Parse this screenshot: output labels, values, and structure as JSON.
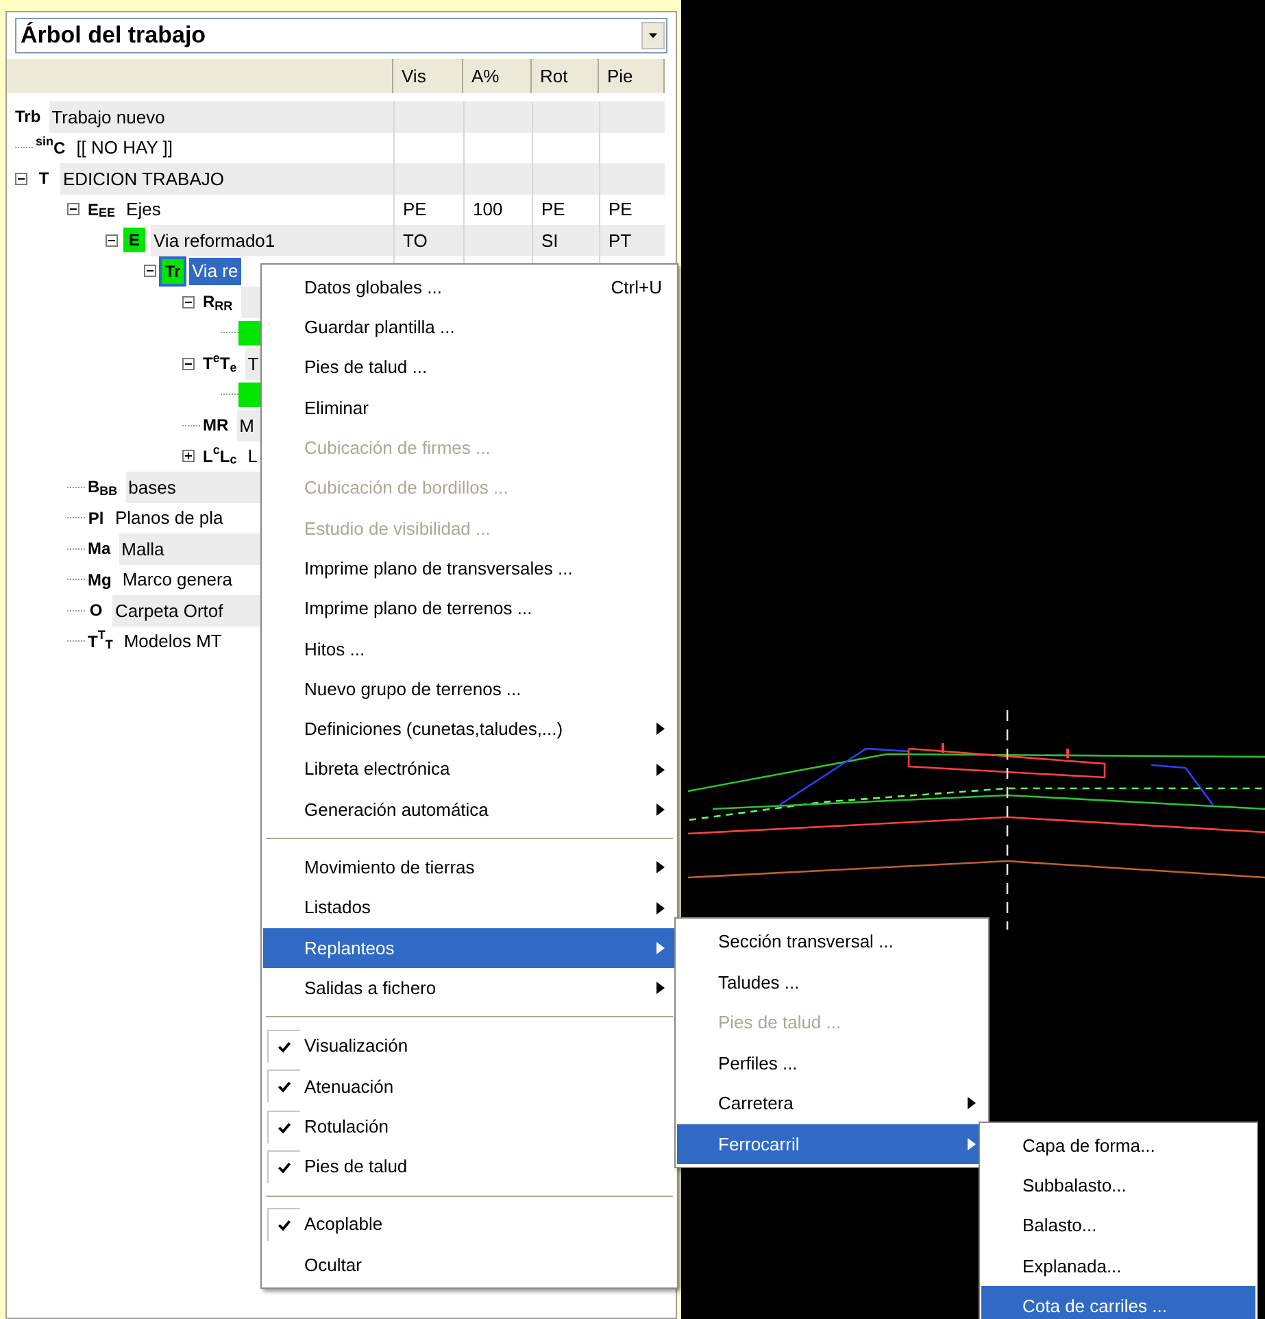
{
  "tree_panel": {
    "title": "Árbol del trabajo",
    "columns": [
      "Vis",
      "A%",
      "Rot",
      "Pie"
    ],
    "rows": [
      {
        "badge": "Trb",
        "label": "Trabajo nuevo",
        "selected": false,
        "children": [
          {
            "badge": "$^{sin}$C",
            "label": "[[ NO HAY ]]",
            "selected": false
          },
          {
            "badge": "T",
            "label": "EDICION TRABAJO",
            "selected": false,
            "expanded": true,
            "children": [
              {
                "badge": "E$_{E}$$_{E}$",
                "label": "Ejes",
                "selected": false,
                "expanded": true,
                "cells": [
                  "PE",
                  "100",
                  "PE",
                  "PE"
                ],
                "children": [
                  {
                    "badge": "E",
                    "color": "#00e600",
                    "label": "Via reformado1",
                    "selected": false,
                    "expanded": true,
                    "cells": [
                      "TO",
                      null,
                      "SI",
                      "PT"
                    ],
                    "children": [
                      {
                        "badge": "Tr",
                        "color": "#00e600",
                        "label": "Via re",
                        "selected": true,
                        "expanded": true,
                        "children": [
                          {
                            "badge": "R$_{R}$$_{R}$",
                            "selected": false,
                            "expanded": true,
                            "children": [
                              {
                                "color": "#00e600",
                                "selected": false
                              }
                            ]
                          },
                          {
                            "badge": "T$^{e}$T$_{e}$",
                            "label": "T",
                            "selected": false,
                            "expanded": true,
                            "children": [
                              {
                                "color": "#00e600",
                                "selected": false
                              }
                            ]
                          },
                          {
                            "badge": "MR",
                            "label": "M",
                            "selected": false
                          },
                          {
                            "badge": "L$^{c}$L$_{c}$",
                            "label": "L",
                            "selected": false,
                            "expanded": false
                          }
                        ]
                      }
                    ]
                  }
                ]
              },
              {
                "badge": "B$_{B}$$_{B}$",
                "label": "bases",
                "selected": false
              },
              {
                "badge": "Pl",
                "label": "Planos de pla",
                "selected": false
              },
              {
                "badge": "Ma",
                "label": "Malla",
                "selected": false
              },
              {
                "badge": "Mg",
                "label": "Marco genera",
                "selected": false
              },
              {
                "badge": "O",
                "label": "Carpeta Ortof",
                "selected": false
              },
              {
                "badge": "T$^{T}$$_{T}$",
                "label": "Modelos MT",
                "selected": false
              }
            ]
          }
        ]
      }
    ]
  },
  "context_menu": {
    "items": [
      {
        "label": "Datos globales ...",
        "shortcut": "Ctrl+U",
        "disabled": false,
        "selected": false
      },
      {
        "label": "Guardar plantilla ...",
        "disabled": false,
        "selected": false
      },
      {
        "label": "Pies de talud ...",
        "disabled": false,
        "selected": false
      },
      {
        "label": "Eliminar",
        "disabled": false,
        "selected": false
      },
      {
        "label": "Cubicación de firmes ...",
        "disabled": true,
        "selected": false
      },
      {
        "label": "Cubicación de bordillos ...",
        "disabled": true,
        "selected": false
      },
      {
        "label": "Estudio de visibilidad ...",
        "disabled": true,
        "selected": false
      },
      {
        "label": "Imprime plano de transversales ...",
        "disabled": false,
        "selected": false
      },
      {
        "label": "Imprime plano de terrenos ...",
        "disabled": false,
        "selected": false
      },
      {
        "label": "Hitos ...",
        "disabled": false,
        "selected": false
      },
      {
        "label": "Nuevo grupo de terrenos ...",
        "disabled": false,
        "selected": false
      },
      {
        "kind": "submenu",
        "label": "Definiciones (cunetas,taludes,...)",
        "disabled": false,
        "selected": false
      },
      {
        "kind": "submenu",
        "label": "Libreta electrónica",
        "disabled": false,
        "selected": false
      },
      {
        "kind": "submenu",
        "label": "Generación automática",
        "disabled": false,
        "selected": false
      },
      {
        "kind": "separator"
      },
      {
        "kind": "submenu",
        "label": "Movimiento de tierras",
        "disabled": false,
        "selected": false
      },
      {
        "kind": "submenu",
        "label": "Listados",
        "disabled": false,
        "selected": false
      },
      {
        "kind": "submenu",
        "label": "Replanteos",
        "disabled": false,
        "selected": true
      },
      {
        "kind": "submenu",
        "label": "Salidas a fichero",
        "disabled": false,
        "selected": false
      },
      {
        "kind": "separator"
      },
      {
        "kind": "check",
        "label": "Visualización",
        "checked": true,
        "disabled": false,
        "selected": false
      },
      {
        "kind": "check",
        "label": "Atenuación",
        "checked": true,
        "disabled": false,
        "selected": false
      },
      {
        "kind": "check",
        "label": "Rotulación",
        "checked": true,
        "disabled": false,
        "selected": false
      },
      {
        "kind": "check",
        "label": "Pies de talud",
        "checked": true,
        "disabled": false,
        "selected": false
      },
      {
        "kind": "separator"
      },
      {
        "kind": "check",
        "label": "Acoplable",
        "checked": true,
        "disabled": false,
        "selected": false
      },
      {
        "kind": "check",
        "label": "Ocultar",
        "checked": false,
        "disabled": false,
        "selected": false
      }
    ]
  },
  "replanteos_submenu": {
    "items": [
      {
        "label": "Sección transversal ...",
        "disabled": false,
        "selected": false
      },
      {
        "label": "Taludes ...",
        "disabled": false,
        "selected": false
      },
      {
        "label": "Pies de talud ...",
        "disabled": true,
        "selected": false
      },
      {
        "label": "Perfiles ...",
        "disabled": false,
        "selected": false
      },
      {
        "kind": "submenu",
        "label": "Carretera",
        "disabled": false,
        "selected": false
      },
      {
        "kind": "submenu",
        "label": "Ferrocarril",
        "disabled": false,
        "selected": true
      }
    ]
  },
  "ferrocarril_submenu": {
    "items": [
      {
        "label": "Capa de forma...",
        "disabled": false,
        "selected": false
      },
      {
        "label": "Subbalasto...",
        "disabled": false,
        "selected": false
      },
      {
        "label": "Balasto...",
        "disabled": false,
        "selected": false
      },
      {
        "label": "Explanada...",
        "disabled": false,
        "selected": false
      },
      {
        "label": "Cota de carriles ...",
        "disabled": false,
        "selected": true
      }
    ]
  }
}
